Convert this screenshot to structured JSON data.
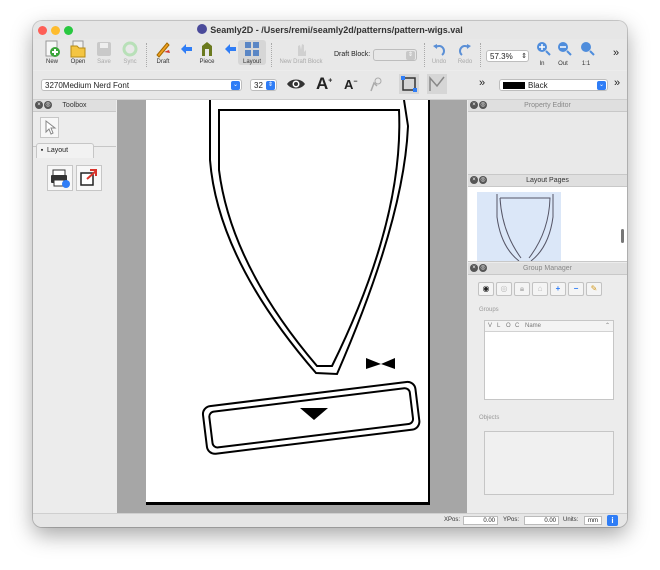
{
  "window": {
    "title": "Seamly2D - /Users/remi/seamly2d/patterns/pattern-wigs.val"
  },
  "toolbar": {
    "new": "New",
    "open": "Open",
    "save": "Save",
    "sync": "Sync",
    "draft": "Draft",
    "piece": "Piece",
    "layout": "Layout",
    "new_draft_block": "New Draft Block",
    "draft_block_label": "Draft Block:",
    "undo": "Undo",
    "redo": "Redo",
    "zoom_value": "57.3%",
    "zoom_in": "In",
    "zoom_out": "Out",
    "zoom_one": "1:1",
    "more": "»"
  },
  "toolbar2": {
    "font_name": "3270Medium Nerd Font",
    "font_size": "32",
    "color_label": "Black",
    "color_swatch": "#000000",
    "more": "»"
  },
  "toolbox": {
    "title": "Toolbox",
    "tab_label": "Layout"
  },
  "right": {
    "property_editor": "Property Editor",
    "layout_pages": "Layout Pages",
    "group_manager": "Group Manager",
    "groups_label": "Groups",
    "groups_columns": [
      "V",
      "L",
      "O",
      "C",
      "Name"
    ],
    "objects_label": "Objects"
  },
  "status": {
    "xpos_label": "XPos:",
    "xpos_value": "0.00",
    "ypos_label": "YPos:",
    "ypos_value": "0.00",
    "units_label": "Units:",
    "units_value": "mm"
  },
  "colors": {
    "accent": "#2f7df6",
    "canvas_bg": "#a6a6a6",
    "paper": "#ffffff"
  }
}
